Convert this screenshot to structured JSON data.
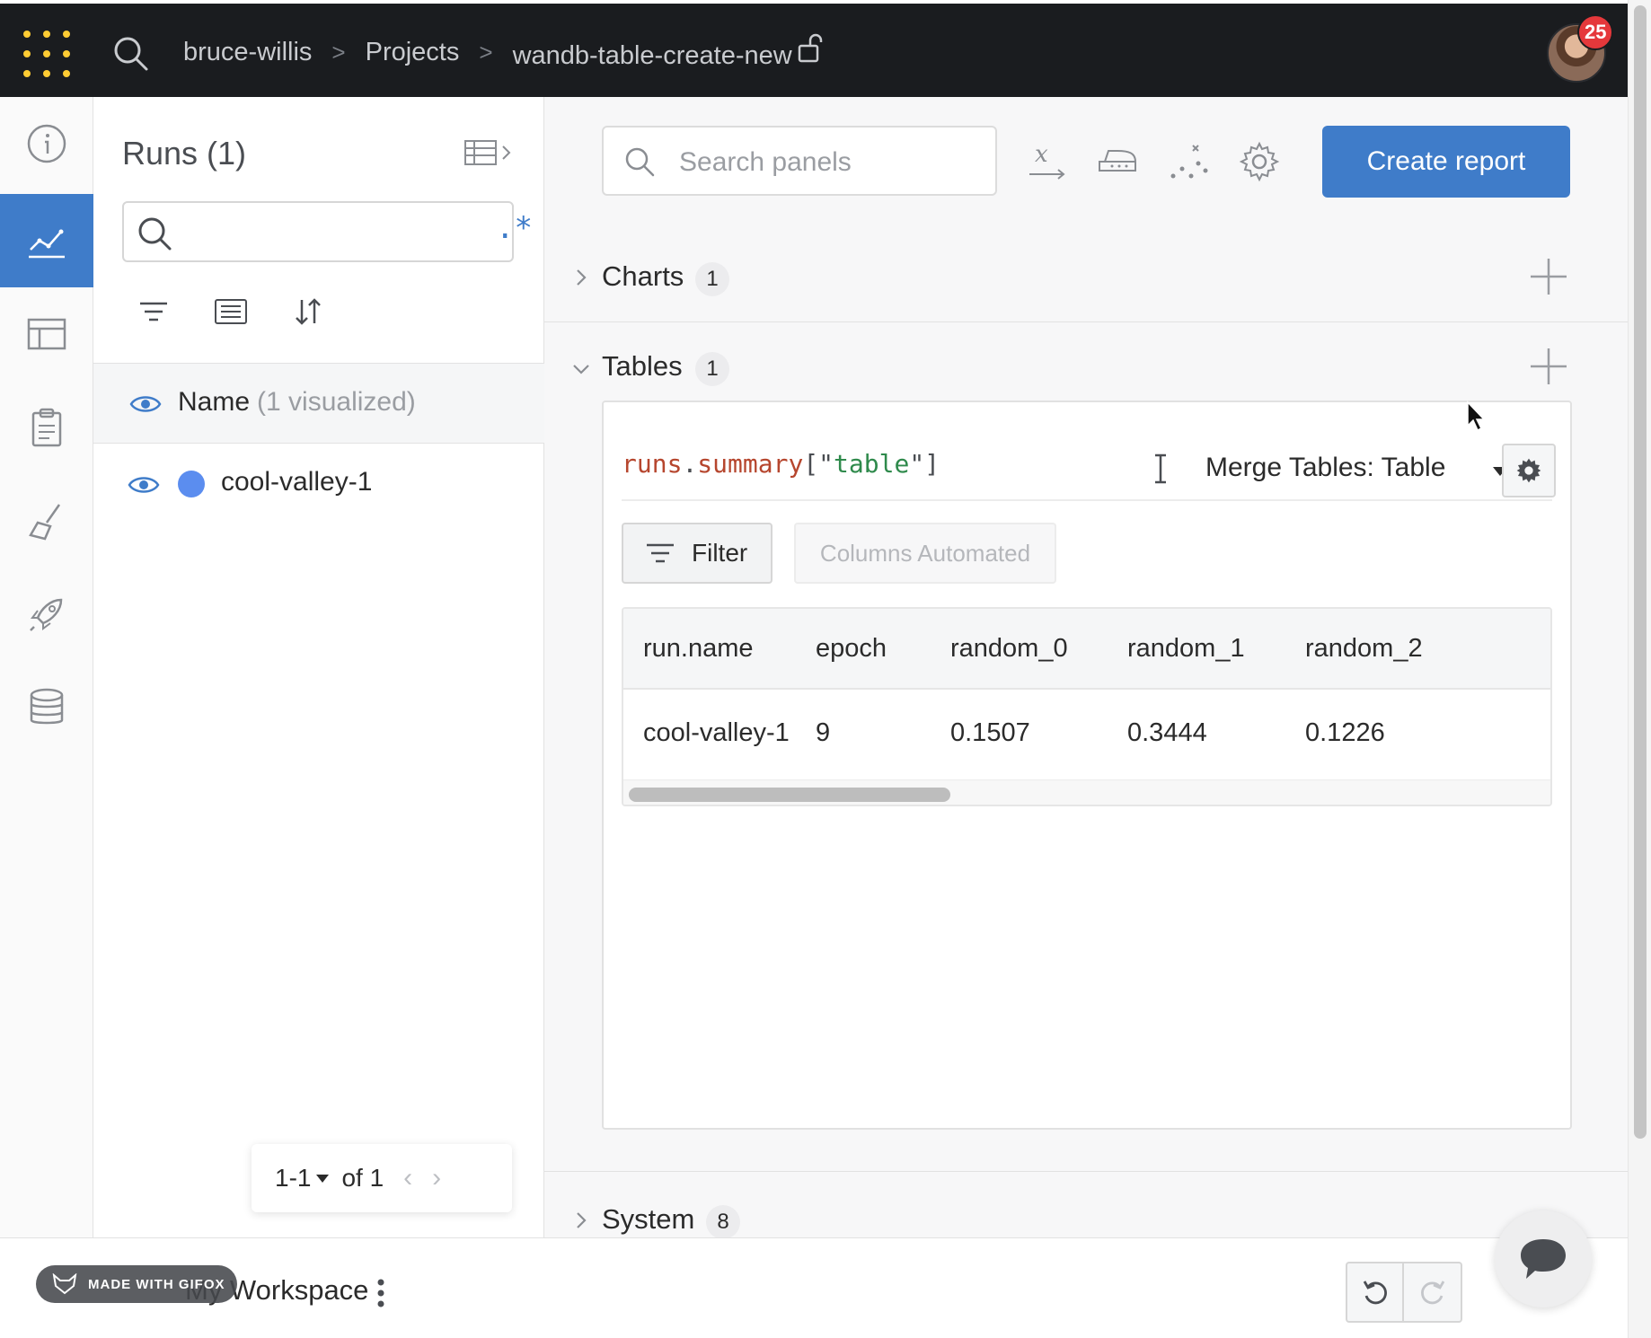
{
  "topbar": {
    "breadcrumbs": [
      "bruce-willis",
      "Projects",
      "wandb-table-create-new"
    ],
    "separator": ">",
    "notification_count": "25"
  },
  "leftnav": {
    "items": [
      "info-icon",
      "charts-icon",
      "table-icon",
      "report-icon",
      "sweep-brush-icon",
      "launch-rocket-icon",
      "artifacts-database-icon"
    ],
    "active_index": 1
  },
  "runs": {
    "title": "Runs (1)",
    "search_value": "",
    "regex_label": ".*",
    "header_name": "Name",
    "header_visualized": "(1 visualized)",
    "rows": [
      {
        "name": "cool-valley-1",
        "color": "#5b8def"
      }
    ],
    "pager": {
      "range": "1-1",
      "of": "of 1",
      "prev": "‹",
      "next": "›"
    }
  },
  "main": {
    "search_placeholder": "Search panels",
    "create_report_label": "Create report",
    "sections": [
      {
        "title": "Charts",
        "count": "1",
        "expanded": false
      },
      {
        "title": "Tables",
        "count": "1",
        "expanded": true
      },
      {
        "title": "System",
        "count": "8",
        "expanded": false
      }
    ],
    "table_panel": {
      "expr_runs": "runs",
      "expr_dot": ".",
      "expr_summary": "summary",
      "expr_open": "[\"",
      "expr_key": "table",
      "expr_close": "\"]",
      "merge_label": "Merge Tables: Table",
      "filter_label": "Filter",
      "columns_label": "Columns Automated",
      "columns": [
        "run.name",
        "epoch",
        "random_0",
        "random_1",
        "random_2"
      ],
      "rows": [
        [
          "cool-valley-1",
          "9",
          "0.1507",
          "0.3444",
          "0.1226"
        ]
      ],
      "horizontal_scroll_fraction": 0.35
    }
  },
  "bottombar": {
    "workspace_label": "My Workspace",
    "watermark": "MADE WITH GIFOX"
  },
  "colors": {
    "accent": "#3f7cc9",
    "topbar": "#1a1c1f",
    "logo": "#ffcc33",
    "badge": "#e5383b"
  }
}
